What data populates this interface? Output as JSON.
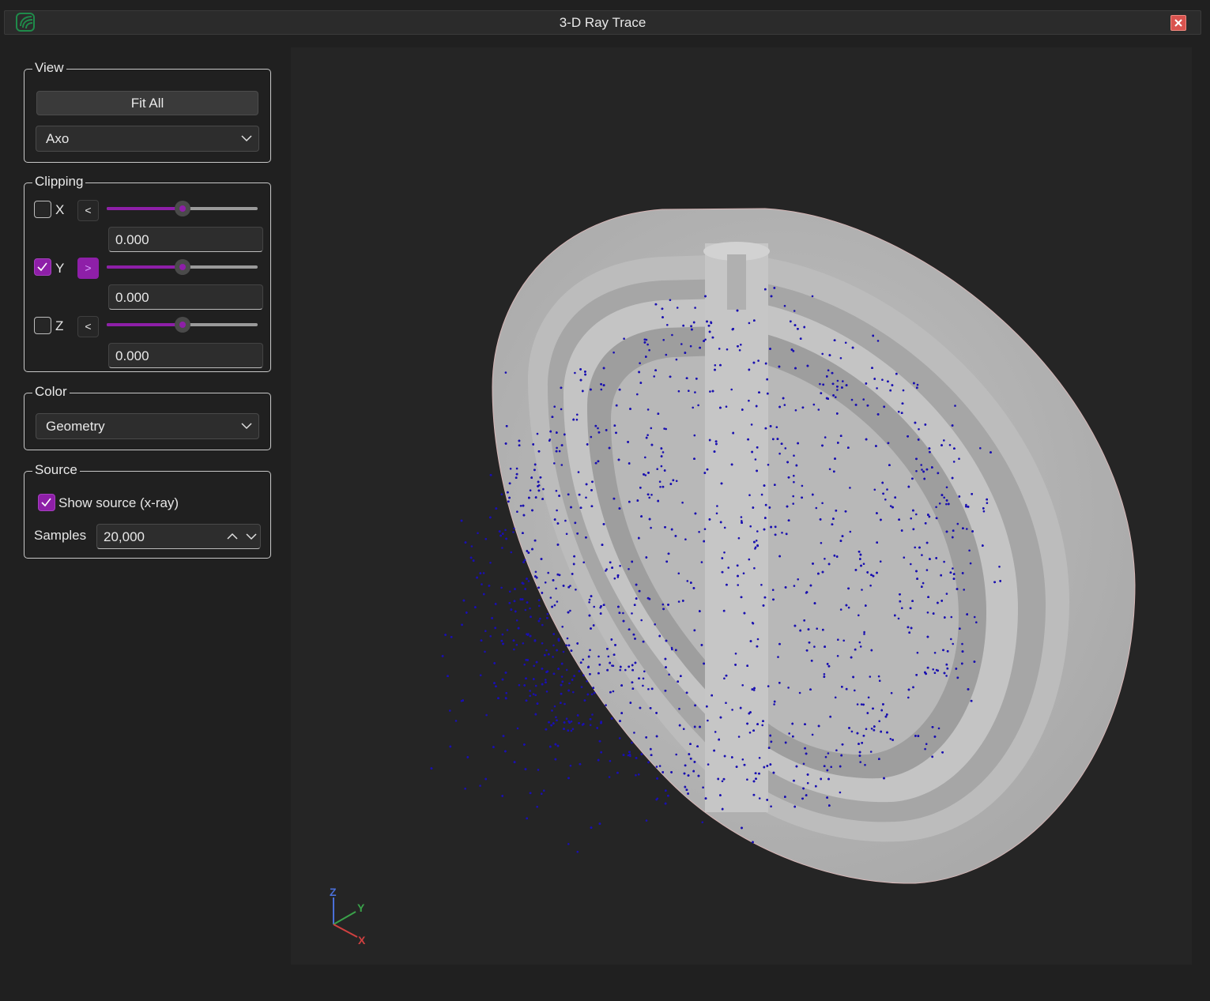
{
  "window": {
    "title": "3-D Ray Trace"
  },
  "view": {
    "group_label": "View",
    "fit_all_label": "Fit All",
    "projection_value": "Axo"
  },
  "clipping": {
    "group_label": "Clipping",
    "axes": [
      {
        "label": "X",
        "checked": false,
        "direction": "<",
        "value": "0.000",
        "slider_fraction": 0.5
      },
      {
        "label": "Y",
        "checked": true,
        "direction": ">",
        "value": "0.000",
        "slider_fraction": 0.5
      },
      {
        "label": "Z",
        "checked": false,
        "direction": "<",
        "value": "0.000",
        "slider_fraction": 0.5
      }
    ]
  },
  "color": {
    "group_label": "Color",
    "mode_value": "Geometry"
  },
  "source": {
    "group_label": "Source",
    "show_source_label": "Show source (x-ray)",
    "show_source_checked": true,
    "samples_label": "Samples",
    "samples_value": "20,000"
  },
  "axis_triad": {
    "x": "X",
    "y": "Y",
    "z": "Z"
  },
  "colors": {
    "accent": "#8e1fa8",
    "particle": "#1a10b0",
    "geometry": "#b4b4b4",
    "background": "#202020",
    "close": "#d9534f"
  }
}
